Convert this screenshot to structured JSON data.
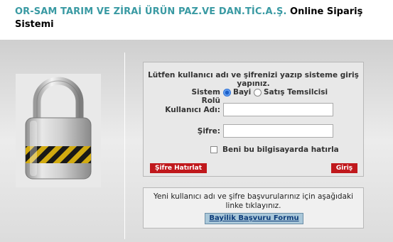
{
  "header": {
    "company": "OR-SAM TARIM VE ZİRAİ ÜRÜN PAZ.VE DAN.TİC.A.Ş.",
    "system_title": "Online Sipariş Sistemi"
  },
  "login": {
    "prompt": "Lütfen kullanıcı adı ve şifrenizi yazıp sisteme giriş yapınız.",
    "role_label": "Sistem Rolü",
    "role_options": [
      "Bayi",
      "Satış Temsilcisi"
    ],
    "role_selected": "Bayi",
    "username_label": "Kullanıcı Adı:",
    "username_value": "",
    "password_label": "Şifre:",
    "password_value": "",
    "remember_label": "Beni bu bilgisayarda hatırla",
    "remember_checked": false,
    "forgot_button": "Şifre Hatırlat",
    "login_button": "Giriş"
  },
  "info": {
    "text": "Yeni kullanıcı adı ve şifre başvurularınız için aşağıdaki linke tıklayınız.",
    "apply_button": "Bayilik Başvuru Formu"
  },
  "icons": {
    "lock": "padlock-icon"
  },
  "colors": {
    "company_teal": "#3a9aa3",
    "button_red": "#c0181c",
    "apply_blue": "#a9c7d9"
  }
}
